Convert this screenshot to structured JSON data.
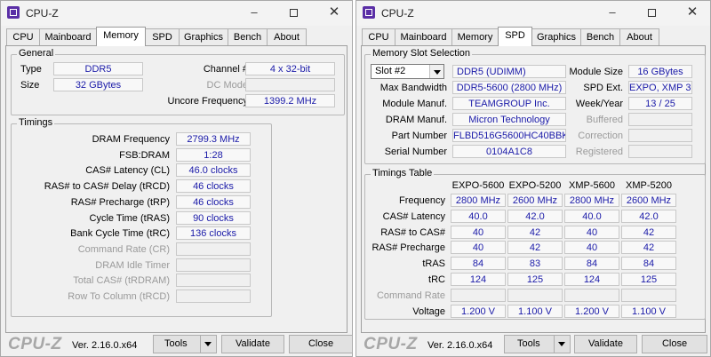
{
  "left": {
    "title": "CPU-Z",
    "tabs": [
      "CPU",
      "Mainboard",
      "Memory",
      "SPD",
      "Graphics",
      "Bench",
      "About"
    ],
    "active_tab": "Memory",
    "general": {
      "title": "General",
      "type_label": "Type",
      "type_value": "DDR5",
      "size_label": "Size",
      "size_value": "32 GBytes",
      "channel_label": "Channel #",
      "channel_value": "4 x 32-bit",
      "dcmode_label": "DC Mode",
      "dcmode_value": "",
      "uncore_label": "Uncore Frequency",
      "uncore_value": "1399.2 MHz"
    },
    "timings": {
      "title": "Timings",
      "rows": [
        {
          "label": "DRAM Frequency",
          "value": "2799.3 MHz",
          "enabled": true
        },
        {
          "label": "FSB:DRAM",
          "value": "1:28",
          "enabled": true
        },
        {
          "label": "CAS# Latency (CL)",
          "value": "46.0 clocks",
          "enabled": true
        },
        {
          "label": "RAS# to CAS# Delay (tRCD)",
          "value": "46 clocks",
          "enabled": true
        },
        {
          "label": "RAS# Precharge (tRP)",
          "value": "46 clocks",
          "enabled": true
        },
        {
          "label": "Cycle Time (tRAS)",
          "value": "90 clocks",
          "enabled": true
        },
        {
          "label": "Bank Cycle Time (tRC)",
          "value": "136 clocks",
          "enabled": true
        },
        {
          "label": "Command Rate (CR)",
          "value": "",
          "enabled": false
        },
        {
          "label": "DRAM Idle Timer",
          "value": "",
          "enabled": false
        },
        {
          "label": "Total CAS# (tRDRAM)",
          "value": "",
          "enabled": false
        },
        {
          "label": "Row To Column (tRCD)",
          "value": "",
          "enabled": false
        }
      ]
    },
    "footer": {
      "logo": "CPU-Z",
      "version": "Ver. 2.16.0.x64",
      "tools": "Tools",
      "validate": "Validate",
      "close": "Close"
    }
  },
  "right": {
    "title": "CPU-Z",
    "tabs": [
      "CPU",
      "Mainboard",
      "Memory",
      "SPD",
      "Graphics",
      "Bench",
      "About"
    ],
    "active_tab": "SPD",
    "slot": {
      "title": "Memory Slot Selection",
      "selected": "Slot #2",
      "module_type": "DDR5 (UDIMM)",
      "module_size_label": "Module Size",
      "module_size": "16 GBytes",
      "max_bw_label": "Max Bandwidth",
      "max_bw": "DDR5-5600 (2800 MHz)",
      "spd_ext_label": "SPD Ext.",
      "spd_ext": "EXPO, XMP 3.0",
      "manuf_label": "Module Manuf.",
      "manuf": "TEAMGROUP Inc.",
      "week_label": "Week/Year",
      "week": "13 / 25",
      "dram_manuf_label": "DRAM Manuf.",
      "dram_manuf": "Micron Technology",
      "buffered_label": "Buffered",
      "part_label": "Part Number",
      "part": "FLBD516G5600HC40BBK",
      "correction_label": "Correction",
      "serial_label": "Serial Number",
      "serial": "0104A1C8",
      "registered_label": "Registered"
    },
    "timings_table": {
      "title": "Timings Table",
      "columns": [
        "EXPO-5600",
        "EXPO-5200",
        "XMP-5600",
        "XMP-5200"
      ],
      "rows": [
        {
          "label": "Frequency",
          "values": [
            "2800 MHz",
            "2600 MHz",
            "2800 MHz",
            "2600 MHz"
          ],
          "enabled": true
        },
        {
          "label": "CAS# Latency",
          "values": [
            "40.0",
            "42.0",
            "40.0",
            "42.0"
          ],
          "enabled": true
        },
        {
          "label": "RAS# to CAS#",
          "values": [
            "40",
            "42",
            "40",
            "42"
          ],
          "enabled": true
        },
        {
          "label": "RAS# Precharge",
          "values": [
            "40",
            "42",
            "40",
            "42"
          ],
          "enabled": true
        },
        {
          "label": "tRAS",
          "values": [
            "84",
            "83",
            "84",
            "84"
          ],
          "enabled": true
        },
        {
          "label": "tRC",
          "values": [
            "124",
            "125",
            "124",
            "125"
          ],
          "enabled": true
        },
        {
          "label": "Command Rate",
          "values": [
            "",
            "",
            "",
            ""
          ],
          "enabled": false
        },
        {
          "label": "Voltage",
          "values": [
            "1.200 V",
            "1.100 V",
            "1.200 V",
            "1.100 V"
          ],
          "enabled": true
        }
      ]
    },
    "footer": {
      "logo": "CPU-Z",
      "version": "Ver. 2.16.0.x64",
      "tools": "Tools",
      "validate": "Validate",
      "close": "Close"
    }
  }
}
